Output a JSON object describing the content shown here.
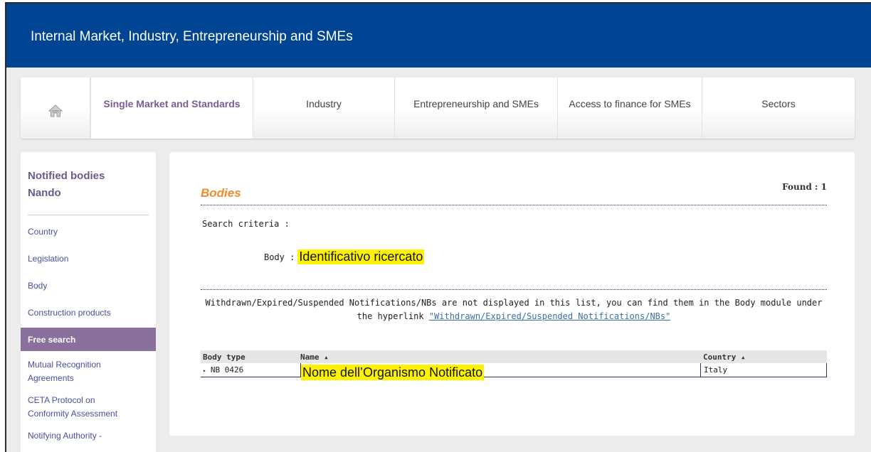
{
  "banner": {
    "title": "Internal Market, Industry, Entrepreneurship and SMEs"
  },
  "nav": {
    "home_icon": "home-icon",
    "items": [
      {
        "label": "Single Market and Standards",
        "active": true
      },
      {
        "label": "Industry"
      },
      {
        "label": "Entrepreneurship and SMEs"
      },
      {
        "label": "Access to finance for SMEs"
      },
      {
        "label": "Sectors"
      }
    ]
  },
  "sidebar": {
    "heading_line1": "Notified bodies",
    "heading_line2": "Nando",
    "items": [
      {
        "label": "Country"
      },
      {
        "label": "Legislation"
      },
      {
        "label": "Body"
      },
      {
        "label": "Construction products"
      },
      {
        "label": "Free search",
        "active": true
      },
      {
        "label_line1": "Mutual Recognition",
        "label_line2": "Agreements"
      },
      {
        "label_line1": "CETA Protocol on",
        "label_line2": "Conformity Assessment"
      },
      {
        "label_line1": "Notifying Authority -"
      }
    ]
  },
  "content": {
    "title": "Bodies",
    "found": "Found : 1",
    "criteria_label": "Search criteria :",
    "body_label": "Body :",
    "body_value": "Identificativo ricercato",
    "notice_text": "Withdrawn/Expired/Suspended Notifications/NBs are not displayed in this list, you can find them in the Body module under the hyperlink ",
    "notice_link": "\"Withdrawn/Expired/Suspended Notifications/NBs\"",
    "table": {
      "headers": {
        "body_type": "Body type",
        "name": "Name ▴",
        "country": "Country ▴"
      },
      "rows": [
        {
          "body_type": "NB 0426",
          "name": "Nome dell’Organismo Notificato",
          "country": "Italy"
        }
      ]
    }
  },
  "colors": {
    "banner": "#004494",
    "active_nav": "#7b5a96",
    "sidebar_active": "#8a719d",
    "title_orange": "#ef8b2c",
    "highlight": "#fff200"
  }
}
